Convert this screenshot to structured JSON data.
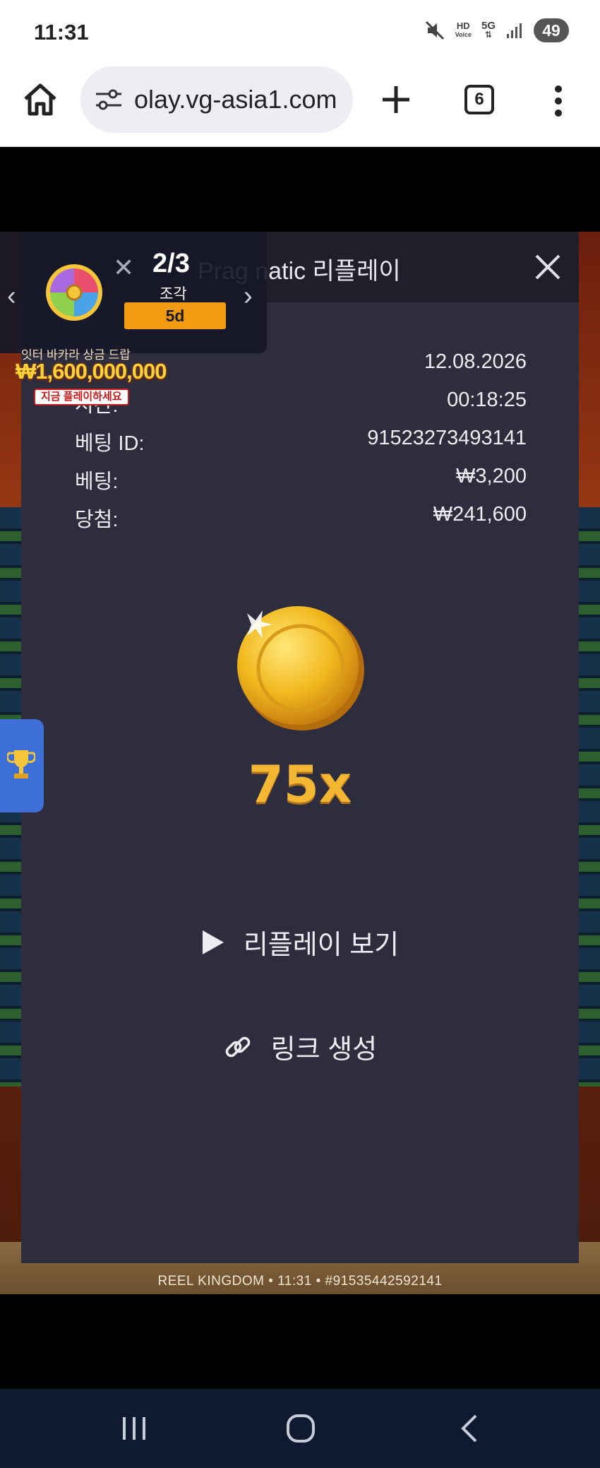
{
  "status": {
    "time": "11:31",
    "battery": "49",
    "icons": [
      "mute-icon",
      "hd-voice-icon",
      "5g-icon",
      "signal-icon",
      "battery-icon"
    ],
    "hd_line1": "HD",
    "hd_line2": "Voice",
    "net": "5G"
  },
  "browser": {
    "url": "olay.vg-asia1.com",
    "tab_count": "6",
    "icons": [
      "home-icon",
      "site-settings-icon",
      "new-tab-icon",
      "tabs-icon",
      "more-menu-icon"
    ]
  },
  "promo": {
    "count": "2/3",
    "unit": "조각",
    "badge": "5d",
    "prev": "‹",
    "next": "›",
    "close": "✕"
  },
  "jackpot": {
    "top_text": "잇터 바카라 상금 드랍",
    "amount": "₩1,600,000,000",
    "cta": "지금 플레이하세요"
  },
  "replay": {
    "title": "Pragmatic 리플레이",
    "title_visible": "Prag natic 리플레이",
    "rows": [
      {
        "label": "",
        "value": "12.08.2026"
      },
      {
        "label": "시간:",
        "value": "00:18:25"
      },
      {
        "label": "베팅 ID:",
        "value": "91523273493141"
      },
      {
        "label": "베팅:",
        "value": "₩3,200"
      },
      {
        "label": "당첨:",
        "value": "₩241,600"
      }
    ],
    "multiplier": "75x",
    "watch_replay": "리플레이 보기",
    "create_link": "링크 생성"
  },
  "game": {
    "footer": "REEL KINGDOM • 11:31 • #91535442592141"
  },
  "colors": {
    "panel_bg": "#2d2d3d",
    "header_bg": "#1f1f2c",
    "multiplier": "#f3b734",
    "badge": "#f19a12",
    "nav_bg": "#0f1930"
  }
}
